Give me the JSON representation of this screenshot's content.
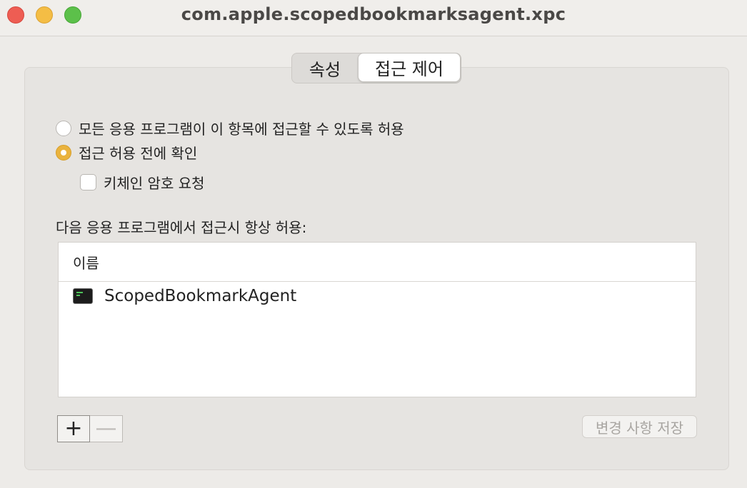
{
  "window": {
    "title": "com.apple.scopedbookmarksagent.xpc"
  },
  "tabs": [
    {
      "label": "속성",
      "selected": false
    },
    {
      "label": "접근 제어",
      "selected": true
    }
  ],
  "access": {
    "option_allow_all": {
      "label": "모든 응용 프로그램이 이 항목에 접근할 수 있도록 허용",
      "checked": false
    },
    "option_confirm": {
      "label": "접근 허용 전에 확인",
      "checked": true
    },
    "require_keychain_password": {
      "label": "키체인 암호 요청",
      "checked": false
    }
  },
  "apps_list": {
    "label": "다음 응용 프로그램에서 접근시 항상 허용:",
    "column_header": "이름",
    "rows": [
      {
        "name": "ScopedBookmarkAgent",
        "icon": "terminal-app-icon"
      }
    ]
  },
  "buttons": {
    "add": "+",
    "remove": "—",
    "save_changes": "변경 사항 저장"
  },
  "colors": {
    "accent": "#eab33e",
    "window_bg": "#edebe8"
  }
}
